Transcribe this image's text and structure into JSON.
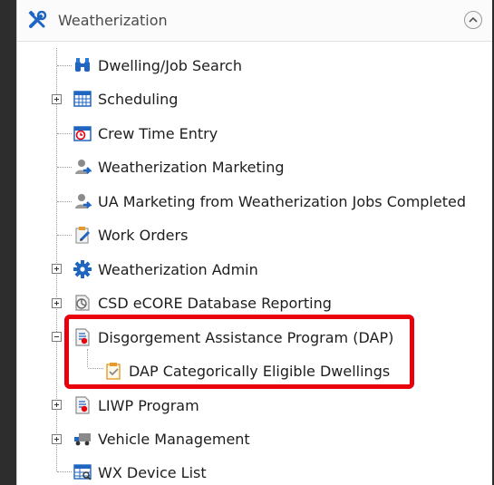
{
  "panel": {
    "title": "Weatherization",
    "title_icon": "tools-icon",
    "collapse_icon": "chevron-up-icon"
  },
  "tree": {
    "items": [
      {
        "label": "Dwelling/Job Search",
        "icon": "binoculars-icon"
      },
      {
        "label": "Scheduling",
        "icon": "calendar-grid-icon",
        "expandable": true,
        "expanded": false
      },
      {
        "label": "Crew Time Entry",
        "icon": "clock-calendar-icon"
      },
      {
        "label": "Weatherization Marketing",
        "icon": "user-marketing-icon"
      },
      {
        "label": "UA Marketing from Weatherization Jobs Completed",
        "icon": "user-marketing-icon"
      },
      {
        "label": "Work Orders",
        "icon": "clipboard-pencil-icon"
      },
      {
        "label": "Weatherization Admin",
        "icon": "gear-icon",
        "expandable": true,
        "expanded": false
      },
      {
        "label": "CSD eCORE Database Reporting",
        "icon": "report-icon",
        "expandable": true,
        "expanded": false
      },
      {
        "label": "Disgorgement Assistance Program (DAP)",
        "icon": "document-icon",
        "expandable": true,
        "expanded": true
      },
      {
        "label": "DAP Categorically Eligible Dwellings",
        "icon": "clipboard-check-icon",
        "child": true
      },
      {
        "label": "LIWP Program",
        "icon": "document-icon",
        "expandable": true,
        "expanded": false
      },
      {
        "label": "Vehicle Management",
        "icon": "truck-icon",
        "expandable": true,
        "expanded": false
      },
      {
        "label": "WX Device List",
        "icon": "device-list-icon"
      }
    ]
  },
  "colors": {
    "highlight": "#e8000d",
    "icon_blue": "#1f66c2",
    "icon_orange": "#e59a2a"
  }
}
